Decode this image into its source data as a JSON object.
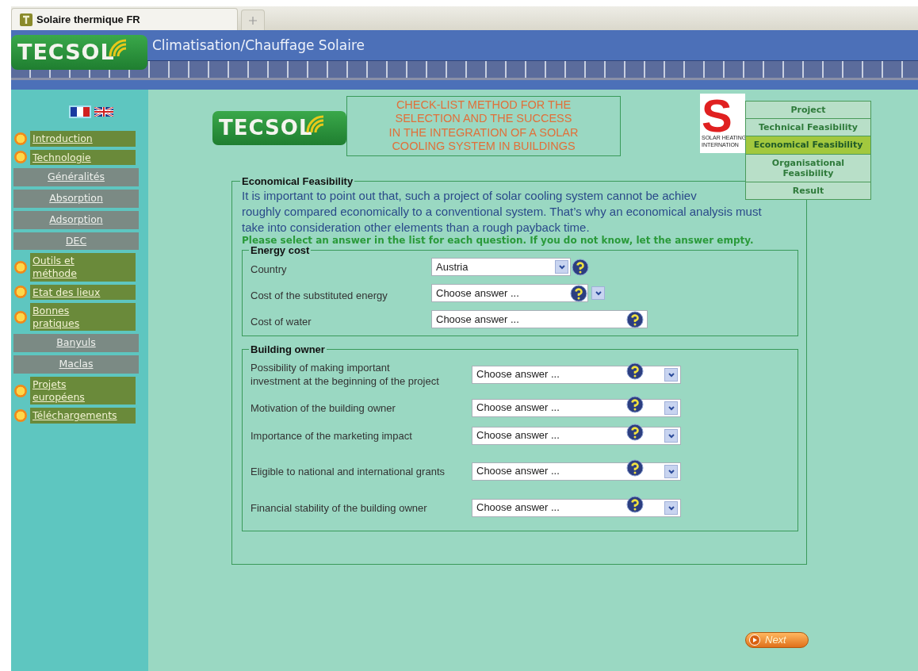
{
  "browser": {
    "tabs": [
      {
        "title": "Solaire thermique FR",
        "selected": true
      }
    ]
  },
  "header": {
    "logo": "TECSOL",
    "title": "Climatisation/Chauffage Solaire"
  },
  "sidebar": {
    "flags": [
      {
        "kind": "fr",
        "selected": true
      },
      {
        "kind": "uk",
        "selected": false
      }
    ],
    "items": [
      {
        "kind": "main",
        "label": "Introduction"
      },
      {
        "kind": "main",
        "label": "Technologie"
      },
      {
        "kind": "sub",
        "label": "Généralités"
      },
      {
        "kind": "sub",
        "label": "Absorption"
      },
      {
        "kind": "sub",
        "label": "Adsorption"
      },
      {
        "kind": "sub",
        "label": "DEC"
      },
      {
        "kind": "main",
        "label": "Outils et\nméthode"
      },
      {
        "kind": "main",
        "label": "Etat des lieux"
      },
      {
        "kind": "main",
        "label": "Bonnes\npratiques"
      },
      {
        "kind": "sub",
        "label": "Banyuls"
      },
      {
        "kind": "sub",
        "label": "Maclas"
      },
      {
        "kind": "main",
        "label": "Projets\neuropéens"
      },
      {
        "kind": "main",
        "label": "Téléchargements"
      }
    ]
  },
  "content": {
    "logo": "TECSOL",
    "title": "CHECK-LIST METHOD FOR THE\nSELECTION AND THE SUCCESS\nIN THE INTEGRATION OF A SOLAR\nCOOLING SYSTEM IN BUILDINGS",
    "partner_logo": {
      "letter": "S",
      "lines": [
        "SOLAR HEATING",
        "INTERNATION"
      ]
    },
    "steps": [
      {
        "label": "Project",
        "selected": false
      },
      {
        "label": "Technical Feasibility",
        "selected": false
      },
      {
        "label": "Economical Feasibility",
        "selected": true
      },
      {
        "label": "Organisational Feasibility",
        "selected": false
      },
      {
        "label": "Result",
        "selected": false
      }
    ],
    "form": {
      "legend": "Economical Feasibility",
      "intro": [
        "It is important to point out that, such a project of solar cooling system cannot be achiev",
        "roughly compared economically to a conventional system. That’s why an economical analysis must\ntake into consideration other elements than a rough payback time."
      ],
      "instruction": "Please select an answer in the list for each question. If you do not know, let the answer empty.",
      "sections": [
        {
          "legend": "Energy cost",
          "kind": "energy",
          "questions": [
            {
              "label": "Country",
              "value": "Austria",
              "dropdown": true
            },
            {
              "label": "Cost of the substituted energy",
              "value": "Choose answer ...",
              "dropdown": true
            },
            {
              "label": "Cost of water",
              "value": "Choose answer ...",
              "dropdown": false
            }
          ]
        },
        {
          "legend": "Building owner",
          "kind": "owner",
          "questions": [
            {
              "label": "Possibility of making important investment at the beginning of the project",
              "value": "Choose answer ...",
              "dropdown": true
            },
            {
              "label": "Motivation of the building owner",
              "value": "Choose answer ...",
              "dropdown": true
            },
            {
              "label": "Importance of the marketing impact",
              "value": "Choose answer ...",
              "dropdown": true
            },
            {
              "label": "Eligible to national and international grants",
              "value": "Choose answer ...",
              "dropdown": true
            },
            {
              "label": "Financial stability of the building owner",
              "value": "Choose answer ...",
              "dropdown": true
            }
          ]
        }
      ]
    },
    "next_button": "Next"
  }
}
